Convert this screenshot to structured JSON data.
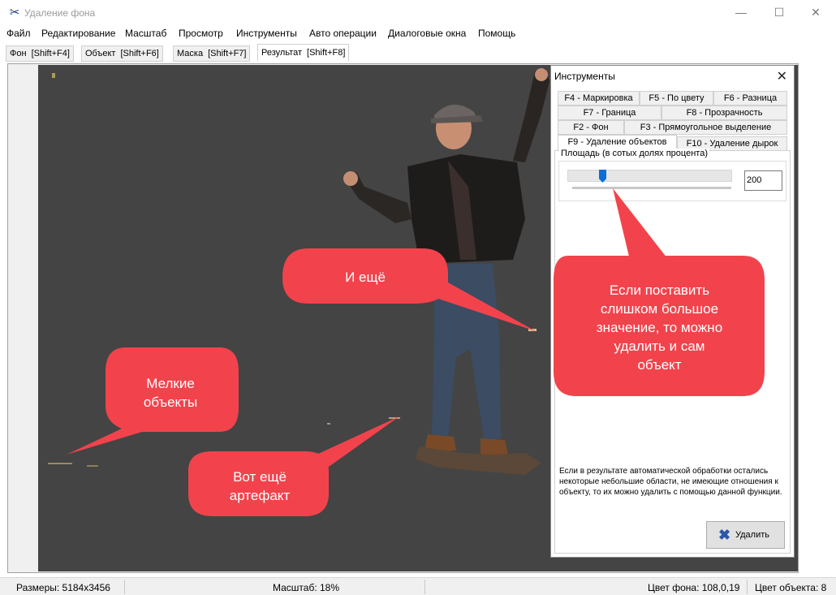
{
  "window": {
    "title": "Удаление фона",
    "app_icon": "scissors-icon",
    "minimize_glyph": "—",
    "maximize_glyph": "☐",
    "close_glyph": "✕"
  },
  "menu": [
    "Файл",
    "Редактирование",
    "Масштаб",
    "Просмотр",
    "Инструменты",
    "Авто операции",
    "Диалоговые окна",
    "Помощь"
  ],
  "tabs": [
    {
      "label": "Фон",
      "shortcut": "[Shift+F4]"
    },
    {
      "label": "Объект",
      "shortcut": "[Shift+F6]"
    },
    {
      "label": "Маска",
      "shortcut": "[Shift+F7]"
    },
    {
      "label": "Результат",
      "shortcut": "[Shift+F8]",
      "active": true
    }
  ],
  "tools_panel": {
    "title": "Инструменты",
    "close_glyph": "✕",
    "tabs": [
      "F4 - Маркировка",
      "F5 - По цвету",
      "F6 - Разница",
      "F7 - Граница",
      "F8 - Прозрачность",
      "F2 - Фон",
      "F3 - Прямоугольное выделение",
      "F9 - Удаление объектов",
      "F10 - Удаление дырок"
    ],
    "active_tab": "F9 - Удаление объектов",
    "area_label": "Площадь (в сотых долях процента)",
    "area_value": "200",
    "slider_position": 0.2,
    "description": "Если в результате автоматической обработки остались некоторые небольшие области, не имеющие отношения к объекту, то их можно удалить с помощью данной функции.",
    "delete_button": "Удалить"
  },
  "annotations": {
    "small_objects": [
      "Мелкие",
      "объекты"
    ],
    "more": [
      "И ещё"
    ],
    "artifact": [
      "Вот ещё",
      "артефакт"
    ],
    "warning": [
      "Если поставить",
      "слишком большое",
      "значение, то можно",
      "удалить и сам",
      "объект"
    ]
  },
  "status": {
    "size": "Размеры: 5184x3456",
    "zoom": "Масштаб: 18%",
    "bg_color": "Цвет фона: 108,0,19",
    "obj_color": "Цвет объекта: 8"
  },
  "colors": {
    "canvas": "#444444",
    "callout": "#f2434c",
    "accent": "#0a6fd6"
  }
}
